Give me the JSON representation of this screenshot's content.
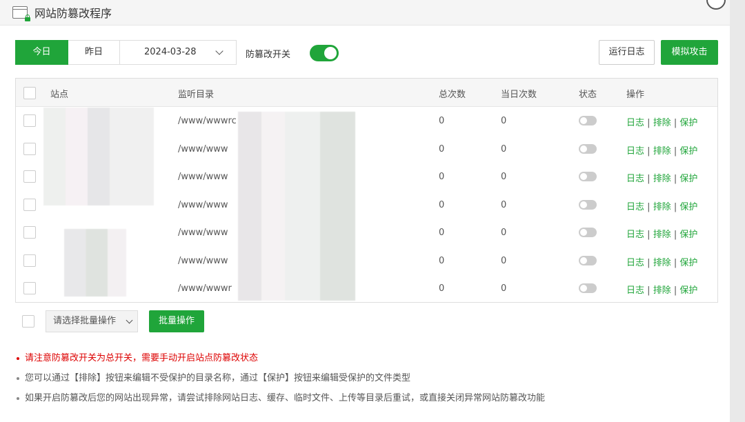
{
  "window": {
    "title": "网站防篡改程序"
  },
  "toolbar": {
    "today_label": "今日",
    "yesterday_label": "昨日",
    "date_value": "2024-03-28",
    "switch_label": "防篡改开关",
    "switch_on": true,
    "log_button": "运行日志",
    "attack_button": "模拟攻击"
  },
  "table": {
    "headers": {
      "site": "站点",
      "dir": "监听目录",
      "total": "总次数",
      "today": "当日次数",
      "status": "状态",
      "ops": "操作"
    },
    "rows": [
      {
        "dir": "/www/wwwrc",
        "total": "0",
        "today": "0"
      },
      {
        "dir": "/www/www",
        "total": "0",
        "today": "0"
      },
      {
        "dir": "/www/www",
        "total": "0",
        "today": "0"
      },
      {
        "dir": "/www/www",
        "total": "0",
        "today": "0"
      },
      {
        "dir": "/www/www",
        "total": "0",
        "today": "0"
      },
      {
        "dir": "/www/www",
        "total": "0",
        "today": "0"
      },
      {
        "dir": "/www/wwwr",
        "total": "0",
        "today": "0"
      }
    ],
    "ops": {
      "log": "日志",
      "exclude": "排除",
      "protect": "保护",
      "sep": "|"
    }
  },
  "batch": {
    "select_placeholder": "请选择批量操作",
    "button": "批量操作"
  },
  "notes": [
    "请注意防篡改开关为总开关，需要手动开启站点防篡改状态",
    "您可以通过【排除】按钮来编辑不受保护的目录名称，通过【保护】按钮来编辑受保护的文件类型",
    "如果开启防篡改后您的网站出现异常，请尝试排除网站日志、缓存、临时文件、上传等目录后重试，或直接关闭异常网站防篡改功能"
  ],
  "colors": {
    "accent": "#20a53a",
    "warning": "#dd0000"
  }
}
